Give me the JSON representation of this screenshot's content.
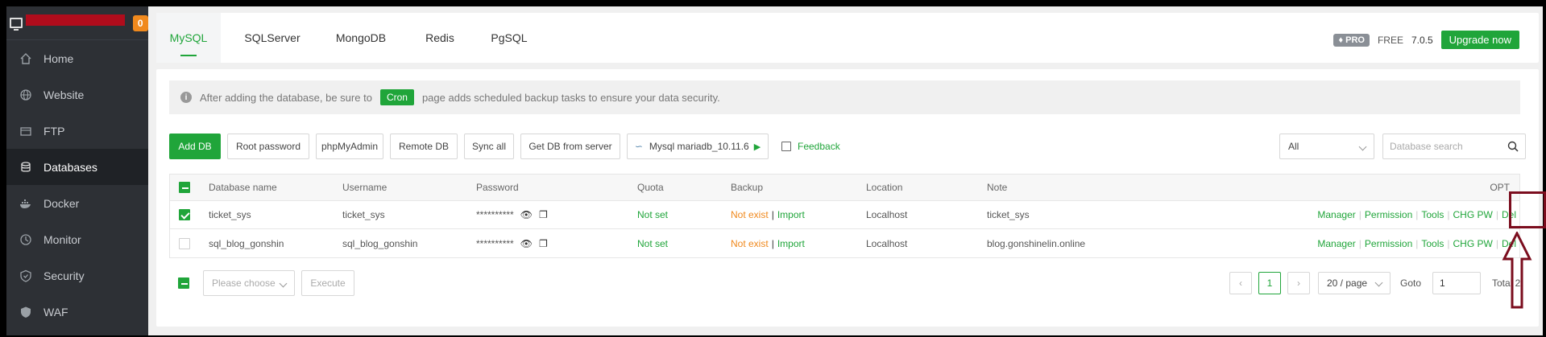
{
  "sidebar": {
    "badge": "0",
    "items": [
      {
        "label": "Home",
        "icon": "home-icon"
      },
      {
        "label": "Website",
        "icon": "globe-icon"
      },
      {
        "label": "FTP",
        "icon": "ftp-icon"
      },
      {
        "label": "Databases",
        "icon": "database-icon",
        "active": true
      },
      {
        "label": "Docker",
        "icon": "docker-icon"
      },
      {
        "label": "Monitor",
        "icon": "monitor-icon"
      },
      {
        "label": "Security",
        "icon": "shield-icon"
      },
      {
        "label": "WAF",
        "icon": "waf-shield-icon"
      }
    ]
  },
  "tabs": [
    "MySQL",
    "SQLServer",
    "MongoDB",
    "Redis",
    "PgSQL"
  ],
  "top_right": {
    "pro": "PRO",
    "free": "FREE",
    "version": "7.0.5",
    "upgrade": "Upgrade now"
  },
  "notice": {
    "before": "After adding the database, be sure to",
    "cron": "Cron",
    "after": "page adds scheduled backup tasks to ensure your data security."
  },
  "toolbar": {
    "add_db": "Add DB",
    "root_password": "Root password",
    "phpmyadmin": "phpMyAdmin",
    "remote_db": "Remote DB",
    "sync_all": "Sync all",
    "get_db": "Get DB from server",
    "mysql_version": "Mysql mariadb_10.11.6",
    "feedback": "Feedback",
    "filter": "All",
    "search_placeholder": "Database search"
  },
  "table": {
    "headers": [
      "Database name",
      "Username",
      "Password",
      "Quota",
      "Backup",
      "Location",
      "Note",
      "OPT"
    ],
    "rows": [
      {
        "name": "ticket_sys",
        "user": "ticket_sys",
        "password": "**********",
        "quota": "Not set",
        "backup_status": "Not exist",
        "import": "Import",
        "location": "Localhost",
        "note": "ticket_sys",
        "checked": true
      },
      {
        "name": "sql_blog_gonshin",
        "user": "sql_blog_gonshin",
        "password": "**********",
        "quota": "Not set",
        "backup_status": "Not exist",
        "import": "Import",
        "location": "Localhost",
        "note": "blog.gonshinelin.online",
        "checked": false
      }
    ],
    "ops": [
      "Manager",
      "Permission",
      "Tools",
      "CHG PW",
      "Del"
    ]
  },
  "bottom": {
    "choose_placeholder": "Please choose",
    "execute": "Execute",
    "page": "1",
    "page_size": "20 / page",
    "goto_label": "Goto",
    "goto_value": "1",
    "total": "Total 2"
  },
  "colors": {
    "accent": "#20a53a",
    "sidebar": "#2d3035",
    "warning": "#f0891d",
    "annotation": "#7b0d1e"
  }
}
